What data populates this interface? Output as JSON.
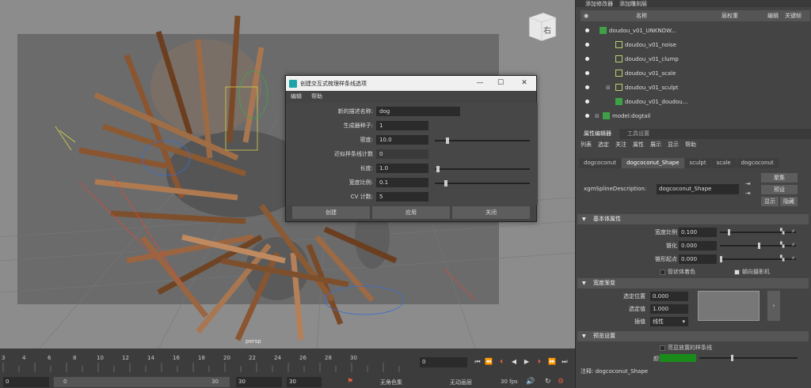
{
  "viewport": {
    "camera_label": "persp",
    "viewcube_label": "右"
  },
  "dialog": {
    "title": "创建交互式梳理样条线选项",
    "menu": [
      "编辑",
      "帮助"
    ],
    "fields": [
      {
        "label": "新的描述名称:",
        "value": "dog"
      },
      {
        "label": "生成器种子:",
        "value": "1"
      },
      {
        "label": "密度:",
        "value": "10.0"
      },
      {
        "label": "近似样条线计数",
        "value": "0"
      },
      {
        "label": "长度:",
        "value": "1.0"
      },
      {
        "label": "宽度比例:",
        "value": "0.1"
      },
      {
        "label": "CV 计数:",
        "value": "5"
      }
    ],
    "buttons": {
      "create": "创建",
      "apply": "应用",
      "close": "关闭"
    }
  },
  "top_toolbar": {
    "add_modifier": "添加修改器",
    "add_layer": "添加雕刻层"
  },
  "outliner": {
    "header": {
      "name": "名称",
      "weight": "层权重",
      "edit": "编辑",
      "keyframe": "关键帧"
    },
    "items": [
      {
        "label": "doudou_v01_UNKNOW..."
      },
      {
        "label": "doudou_v01_noise"
      },
      {
        "label": "doudou_v01_clump"
      },
      {
        "label": "doudou_v01_scale"
      },
      {
        "label": "doudou_v01_sculpt"
      },
      {
        "label": "doudou_v01_doudou..."
      },
      {
        "label": "model:dogtail"
      }
    ]
  },
  "attr_editor": {
    "tabs": [
      "属性编辑器",
      "工具设置"
    ],
    "menu": [
      "列表",
      "选定",
      "关注",
      "属性",
      "展示",
      "显示",
      "帮助"
    ],
    "node_tabs": [
      "dogcoconut",
      "dogcoconut_Shape",
      "sculpt",
      "scale",
      "dogcoconut"
    ],
    "type_label": "xgmSplineDescription:",
    "type_value": "dogcoconut_Shape",
    "btn_focus": "聚集",
    "btn_preset": "预设",
    "btn_show": "显示",
    "btn_hide": "隐藏",
    "sec_basic": "基本体属性",
    "width_scale_label": "宽度比例",
    "width_scale_value": "0.100",
    "taper_label": "锥化",
    "taper_value": "0.000",
    "taper_start_label": "锥形起点",
    "taper_start_value": "0.000",
    "tube_shade": "管状体着色",
    "face_camera": "朝向摄影机",
    "sec_ramp": "宽度渐变",
    "sel_pos_label": "选定位置",
    "sel_pos_value": "0.000",
    "sel_val_label": "选定值",
    "sel_val_value": "1.000",
    "interp_label": "插值",
    "interp_value": "线性",
    "sec_preview": "预览设置",
    "highlight_splines": "亮显放置的样条线",
    "color_label": "颜色",
    "note_label": "注释:",
    "note_value": "dogcoconut_Shape",
    "color_swatch": "#1a8a1a"
  },
  "timeline": {
    "ticks": [
      "3",
      "4",
      "6",
      "8",
      "10",
      "12",
      "14",
      "16",
      "18",
      "20",
      "22",
      "24",
      "26",
      "28",
      "30"
    ],
    "current_frame": "0",
    "range_start": "0",
    "range_inner_start": "0",
    "range_inner_end": "30",
    "range_end": "30",
    "end_frame": "30",
    "no_character": "无角色集",
    "no_anim_layer": "无动画层",
    "fps": "30 fps"
  }
}
